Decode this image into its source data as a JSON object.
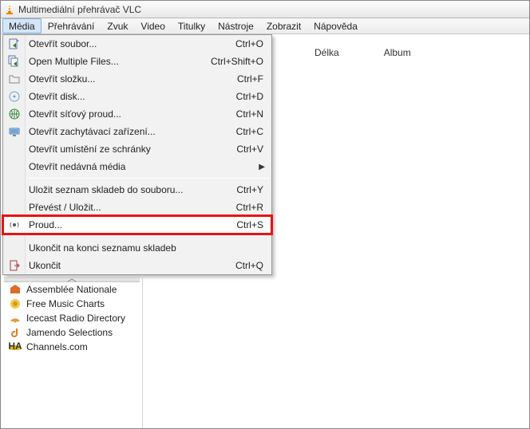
{
  "window": {
    "title": "Multimediální přehrávač VLC"
  },
  "menubar": {
    "items": [
      {
        "label": "Média",
        "active": true
      },
      {
        "label": "Přehrávání"
      },
      {
        "label": "Zvuk"
      },
      {
        "label": "Video"
      },
      {
        "label": "Titulky"
      },
      {
        "label": "Nástroje"
      },
      {
        "label": "Zobrazit"
      },
      {
        "label": "Nápověda"
      }
    ]
  },
  "playlist_columns": {
    "delka": "Délka",
    "album": "Album"
  },
  "media_menu": {
    "groups": [
      [
        {
          "icon": "file-open-icon",
          "label": "Otevřít soubor...",
          "accel": "Ctrl+O"
        },
        {
          "icon": "files-open-icon",
          "label": "Open Multiple Files...",
          "accel": "Ctrl+Shift+O"
        },
        {
          "icon": "folder-icon",
          "label": "Otevřít složku...",
          "accel": "Ctrl+F"
        },
        {
          "icon": "disc-icon",
          "label": "Otevřít disk...",
          "accel": "Ctrl+D"
        },
        {
          "icon": "network-icon",
          "label": "Otevřít síťový proud...",
          "accel": "Ctrl+N"
        },
        {
          "icon": "capture-icon",
          "label": "Otevřít zachytávací zařízení...",
          "accel": "Ctrl+C"
        },
        {
          "icon": "",
          "label": "Otevřít umístění ze schránky",
          "accel": "Ctrl+V"
        },
        {
          "icon": "",
          "label": "Otevřít nedávná média",
          "submenu": true
        }
      ],
      [
        {
          "icon": "",
          "label": "Uložit seznam skladeb do souboru...",
          "accel": "Ctrl+Y"
        },
        {
          "icon": "",
          "label": "Převést / Uložit...",
          "accel": "Ctrl+R"
        },
        {
          "icon": "stream-icon",
          "label": "Proud...",
          "accel": "Ctrl+S",
          "highlight": true
        }
      ],
      [
        {
          "icon": "",
          "label": "Ukončit na konci seznamu skladeb"
        },
        {
          "icon": "quit-icon",
          "label": "Ukončit",
          "accel": "Ctrl+Q"
        }
      ]
    ]
  },
  "sidebar": {
    "items": [
      {
        "icon": "assemblee-icon",
        "label": "Assemblée Nationale"
      },
      {
        "icon": "fmc-icon",
        "label": "Free Music Charts"
      },
      {
        "icon": "icecast-icon",
        "label": "Icecast Radio Directory"
      },
      {
        "icon": "jamendo-icon",
        "label": "Jamendo Selections"
      },
      {
        "icon": "channels-icon",
        "label": "Channels.com"
      }
    ]
  }
}
